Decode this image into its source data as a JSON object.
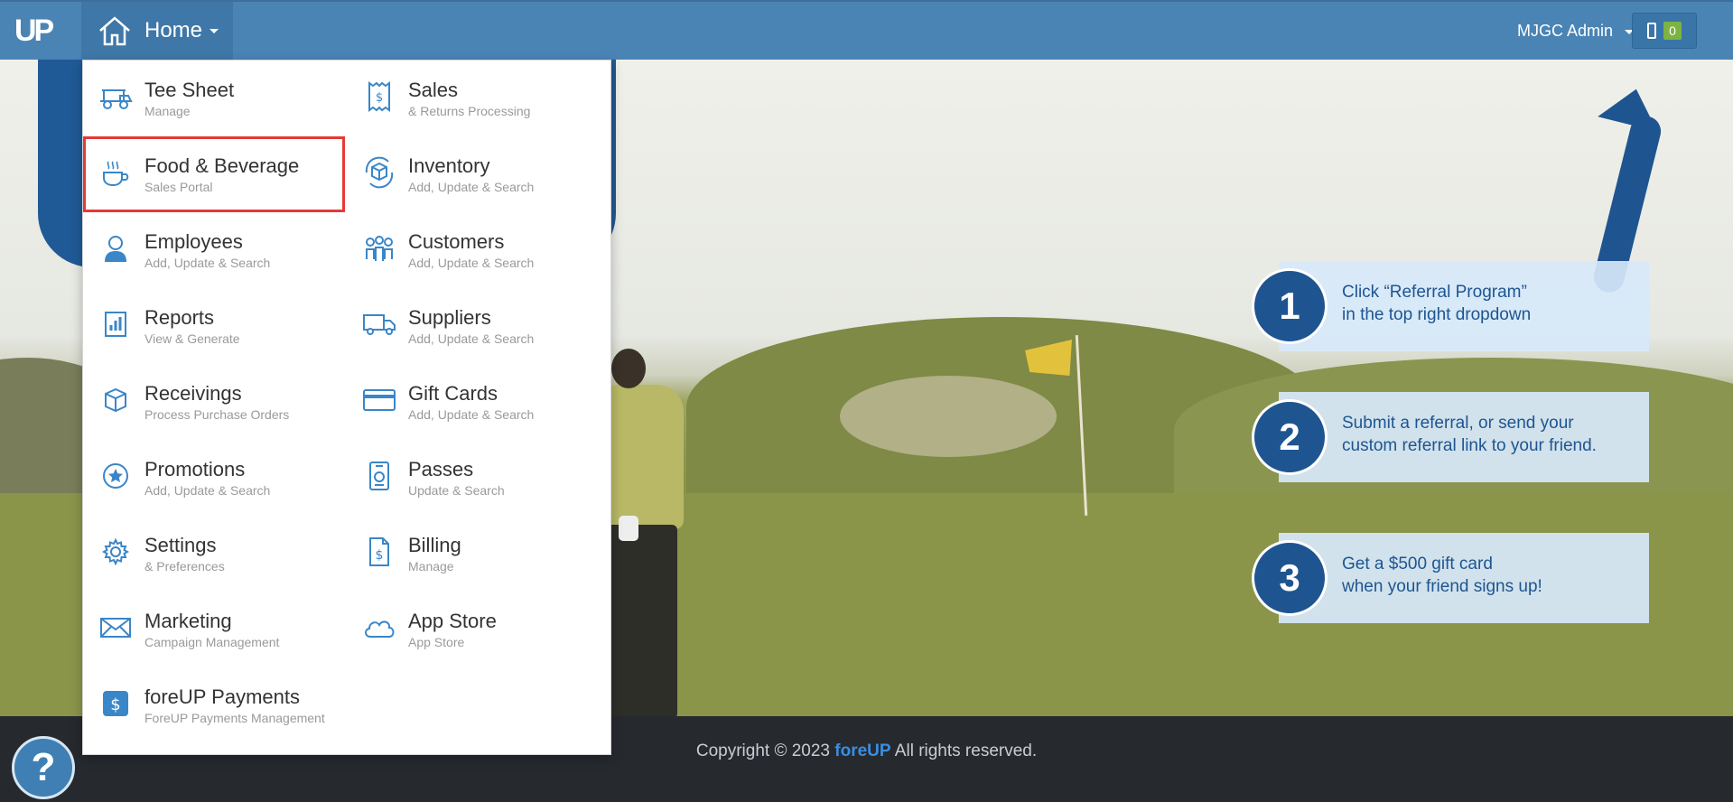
{
  "topbar": {
    "logo": "UP",
    "home_label": "Home",
    "user_label": "MJGC Admin",
    "counter_value": "0",
    "colors": {
      "bar": "#4a84b5",
      "counter_badge": "#7cb342"
    }
  },
  "menu": {
    "items": [
      {
        "title": "Tee Sheet",
        "subtitle": "Manage",
        "icon": "golf-cart-icon"
      },
      {
        "title": "Sales",
        "subtitle": "& Returns Processing",
        "icon": "receipt-dollar-icon"
      },
      {
        "title": "Food & Beverage",
        "subtitle": "Sales Portal",
        "icon": "coffee-cup-icon",
        "highlighted": true
      },
      {
        "title": "Inventory",
        "subtitle": "Add, Update & Search",
        "icon": "box-refresh-icon"
      },
      {
        "title": "Employees",
        "subtitle": "Add, Update & Search",
        "icon": "employee-icon"
      },
      {
        "title": "Customers",
        "subtitle": "Add, Update & Search",
        "icon": "people-group-icon"
      },
      {
        "title": "Reports",
        "subtitle": "View & Generate",
        "icon": "report-chart-icon"
      },
      {
        "title": "Suppliers",
        "subtitle": "Add, Update & Search",
        "icon": "truck-icon"
      },
      {
        "title": "Receivings",
        "subtitle": "Process Purchase Orders",
        "icon": "package-icon"
      },
      {
        "title": "Gift Cards",
        "subtitle": "Add, Update & Search",
        "icon": "credit-card-icon"
      },
      {
        "title": "Promotions",
        "subtitle": "Add, Update & Search",
        "icon": "star-badge-icon"
      },
      {
        "title": "Passes",
        "subtitle": "Update & Search",
        "icon": "pass-id-icon"
      },
      {
        "title": "Settings",
        "subtitle": "& Preferences",
        "icon": "gear-icon"
      },
      {
        "title": "Billing",
        "subtitle": "Manage",
        "icon": "invoice-dollar-icon"
      },
      {
        "title": "Marketing",
        "subtitle": "Campaign Management",
        "icon": "envelope-icon"
      },
      {
        "title": "App Store",
        "subtitle": "App Store",
        "icon": "cloud-icon"
      },
      {
        "title": "foreUP Payments",
        "subtitle": "ForeUP Payments Management",
        "icon": "dollar-square-icon"
      }
    ],
    "highlight_color": "#e53935"
  },
  "referral": {
    "steps": [
      {
        "number": "1",
        "line1": "Click “Referral Program”",
        "line2": "in the top right dropdown"
      },
      {
        "number": "2",
        "line1": "Submit a referral, or send your",
        "line2": "custom referral link to your friend."
      },
      {
        "number": "3",
        "line1": "Get a $500 gift card",
        "line2": "when your friend signs up!"
      }
    ],
    "color": "#1e5591"
  },
  "footer": {
    "copyright_prefix": "Copyright © 2023",
    "brand": "foreUP",
    "copyright_suffix": "All rights reserved.",
    "help_label": "?"
  }
}
